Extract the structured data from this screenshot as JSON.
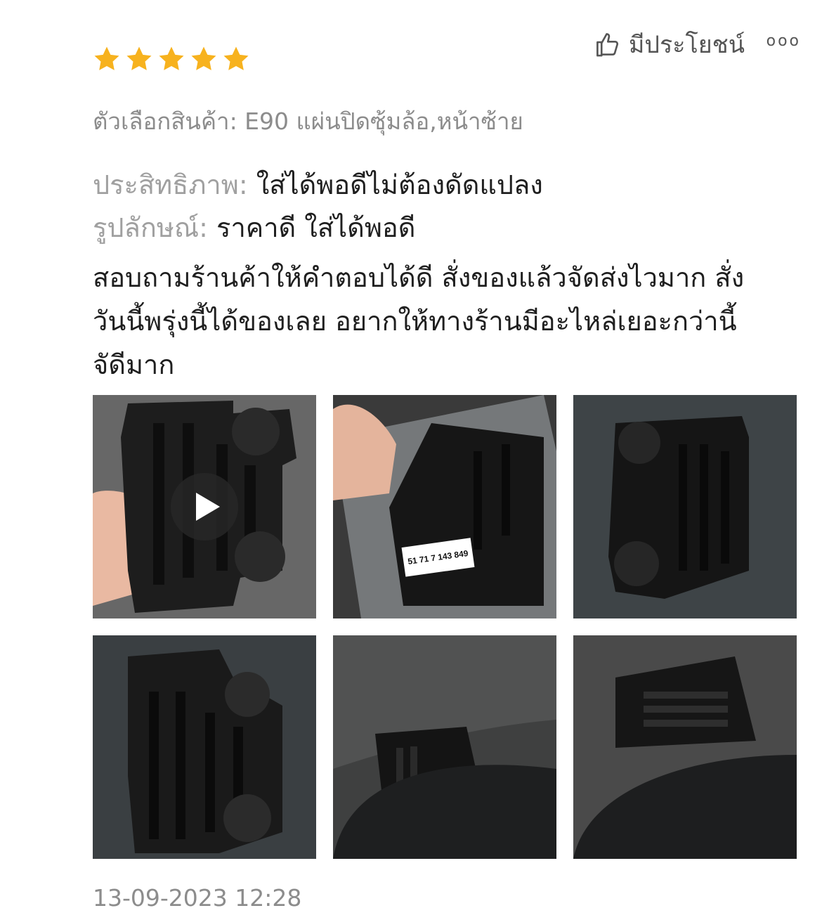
{
  "review": {
    "rating": 5,
    "helpful_label": "มีประโยชน์",
    "more_label": "ooo",
    "variant": "ตัวเลือกสินค้า: E90 แผ่นปิดซุ้มล้อ,หน้าซ้าย",
    "attributes": [
      {
        "key": "ประสิทธิภาพ:",
        "value": "ใส่ได้พอดีไม่ต้องดัดแปลง"
      },
      {
        "key": "รูปลักษณ์:",
        "value": "ราคาดี ใส่ได้พอดี"
      }
    ],
    "body_lines": [
      "สอบถามร้านค้าให้คำตอบได้ดี สั่งของแล้วจัดส่งไวมาก สั่ง",
      "วันนี้พรุ่งนี้ได้ของเลย อยากให้ทางร้านมีอะไหล่เยอะกว่านี้",
      "จัดีมาก"
    ],
    "part_number_label": "51 71 7 143 849",
    "date": "13-09-2023 12:28"
  },
  "colors": {
    "star": "#f7b21e",
    "muted": "#8c8c8c",
    "text": "#1f1f1f"
  }
}
